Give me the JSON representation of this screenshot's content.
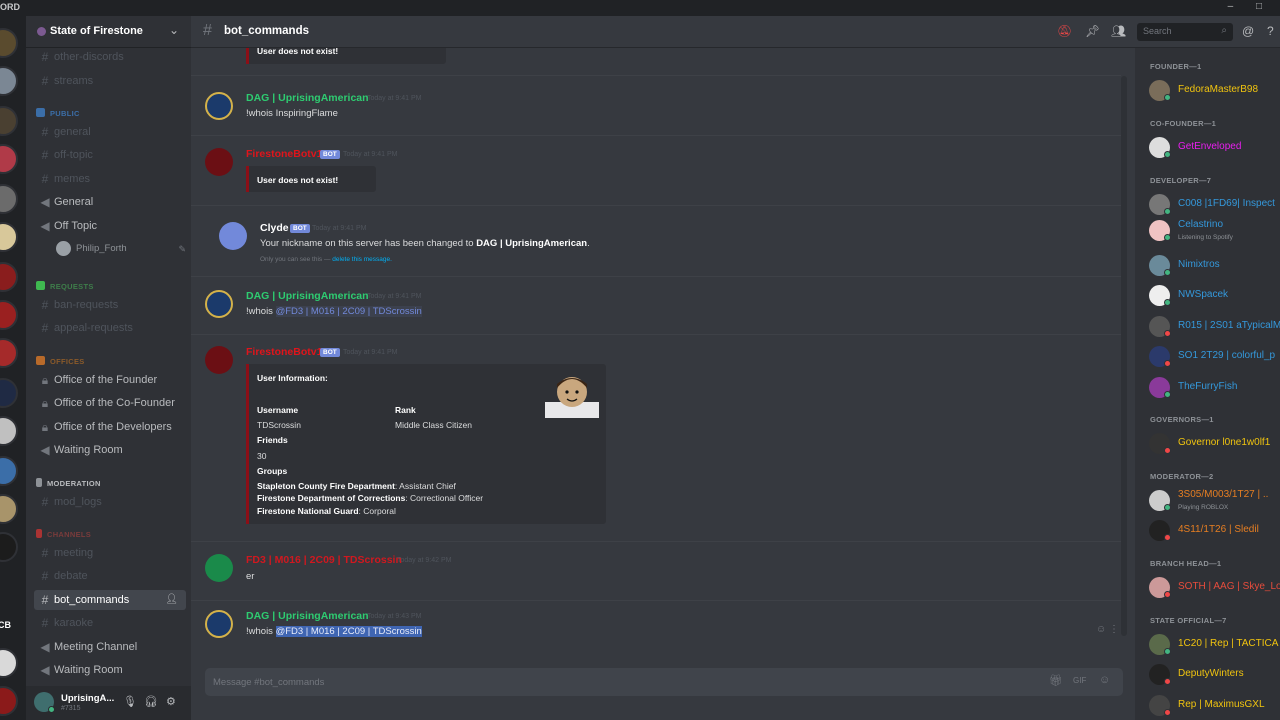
{
  "titlebar": {
    "brand": "ORD",
    "controls": "– □"
  },
  "server": {
    "name": "State of Firestone"
  },
  "channels": [
    {
      "label": "other-discords",
      "kind": "text",
      "state": "muted"
    },
    {
      "label": "streams",
      "kind": "text",
      "state": "muted"
    },
    {
      "label": "general",
      "kind": "text",
      "state": "muted"
    },
    {
      "label": "off-topic",
      "kind": "text",
      "state": "muted"
    },
    {
      "label": "memes",
      "kind": "text",
      "state": "muted"
    },
    {
      "label": "General",
      "kind": "voice",
      "state": "normal"
    },
    {
      "label": "Off Topic",
      "kind": "voice",
      "state": "normal"
    },
    {
      "label": "ban-requests",
      "kind": "text",
      "state": "muted"
    },
    {
      "label": "appeal-requests",
      "kind": "text",
      "state": "muted"
    },
    {
      "label": "Office of the Founder",
      "kind": "locked",
      "state": "normal"
    },
    {
      "label": "Office of the Co-Founder",
      "kind": "locked",
      "state": "normal"
    },
    {
      "label": "Office of the Developers",
      "kind": "locked",
      "state": "normal"
    },
    {
      "label": "Waiting Room",
      "kind": "voice",
      "state": "normal"
    },
    {
      "label": "mod_logs",
      "kind": "text",
      "state": "muted"
    },
    {
      "label": "meeting",
      "kind": "text",
      "state": "muted"
    },
    {
      "label": "debate",
      "kind": "text",
      "state": "muted"
    },
    {
      "label": "bot_commands",
      "kind": "text",
      "state": "active"
    },
    {
      "label": "karaoke",
      "kind": "text",
      "state": "muted"
    },
    {
      "label": "Meeting Channel",
      "kind": "voice",
      "state": "normal"
    },
    {
      "label": "Waiting Room",
      "kind": "voice",
      "state": "normal"
    }
  ],
  "categories": [
    {
      "label": "PUBLIC",
      "color": "#3b6ea8"
    },
    {
      "label": "REQUESTS",
      "color": "#3e7d4a"
    },
    {
      "label": "OFFICES",
      "color": "#8a5a2a"
    },
    {
      "label": "MODERATION",
      "color": "#8e9297"
    },
    {
      "label": "CHANNELS",
      "color": "#7a3b3b"
    }
  ],
  "voice_user": {
    "name": "Philip_Forth"
  },
  "current_user": {
    "name": "UprisingA...",
    "tag": "#7315"
  },
  "topbar": {
    "channel": "bot_commands",
    "search_placeholder": "Search"
  },
  "messages": [
    {
      "author": "",
      "timestamp": "",
      "embed_text": "User does not exist!"
    },
    {
      "author": "DAG | UprisingAmerican",
      "timestamp": "Today at 9:41 PM",
      "text": "!whois InspiringFlame"
    },
    {
      "author": "FirestoneBotv1",
      "bot_tag": "BOT",
      "timestamp": "Today at 9:41 PM",
      "embed_text": "User does not exist!"
    },
    {
      "author": "Clyde",
      "bot_tag": "BOT",
      "timestamp": "Today at 9:41 PM",
      "text_prefix": "Your nickname on this server has been changed to ",
      "text_bold": "DAG | UprisingAmerican",
      "text_suffix": ".",
      "note": "Only you can see this — ",
      "note_link": "delete this message."
    },
    {
      "author": "DAG | UprisingAmerican",
      "timestamp": "Today at 9:41 PM",
      "text": "!whois",
      "mention": "@FD3 | M016 | 2C09 | TDScrossin"
    },
    {
      "author": "FirestoneBotv1",
      "bot_tag": "BOT",
      "timestamp": "Today at 9:41 PM",
      "embed": {
        "title": "User Information:",
        "username_label": "Username",
        "username": "TDScrossin",
        "rank_label": "Rank",
        "rank": "Middle Class Citizen",
        "friends_label": "Friends",
        "friends": "30",
        "groups_label": "Groups",
        "groups": [
          {
            "name": "Stapleton County Fire Department",
            "role": ": Assistant Chief"
          },
          {
            "name": "Firestone Department of Corrections",
            "role": ": Correctional Officer"
          },
          {
            "name": "Firestone National Guard",
            "role": ": Corporal"
          }
        ]
      }
    },
    {
      "author": "FD3 | M016 | 2C09 | TDScrossin",
      "timestamp": "Today at 9:42 PM",
      "text": "er"
    },
    {
      "author": "DAG | UprisingAmerican",
      "timestamp": "Today at 9:43 PM",
      "text": "!whois",
      "mention": "@FD3 | M016 | 2C09 | TDScrossin"
    }
  ],
  "composer": {
    "placeholder": "Message #bot_commands"
  },
  "members": {
    "roles": [
      "FOUNDER—1",
      "CO-FOUNDER—1",
      "DEVELOPER—7",
      "GOVERNORS—1",
      "MODERATOR—2",
      "BRANCH HEAD—1",
      "STATE OFFICIAL—7"
    ],
    "list": [
      {
        "name": "FedoraMasterB98",
        "color": "#f1c40f",
        "status": "#43b581",
        "sub": ""
      },
      {
        "name": "GetEnveloped",
        "color": "#e91ef0",
        "status": "#43b581",
        "sub": ""
      },
      {
        "name": "C008 |1FD69| Inspect",
        "color": "#3498db",
        "status": "#43b581",
        "sub": ""
      },
      {
        "name": "Celastrino",
        "color": "#3498db",
        "status": "#43b581",
        "sub": "Listening to Spotify"
      },
      {
        "name": "Nimixtros",
        "color": "#3498db",
        "status": "#43b581",
        "sub": ""
      },
      {
        "name": "NWSpacek",
        "color": "#3498db",
        "status": "#43b581",
        "sub": ""
      },
      {
        "name": "R015 | 2S01 aTypicalM",
        "color": "#3498db",
        "status": "#f04747",
        "sub": ""
      },
      {
        "name": "SO1 2T29 | colorful_p",
        "color": "#3498db",
        "status": "#f04747",
        "sub": ""
      },
      {
        "name": "TheFurryFish",
        "color": "#3498db",
        "status": "#43b581",
        "sub": ""
      },
      {
        "name": "Governor l0ne1w0lf1",
        "color": "#f1c40f",
        "status": "#f04747",
        "sub": ""
      },
      {
        "name": "3S05/M003/1T27 | ..",
        "color": "#e67e22",
        "status": "#43b581",
        "sub": "Playing ROBLOX"
      },
      {
        "name": "4S11/1T26 | Sledil",
        "color": "#e67e22",
        "status": "#f04747",
        "sub": ""
      },
      {
        "name": "SOTH | AAG | Skye_Lo",
        "color": "#e74c3c",
        "status": "#f04747",
        "sub": ""
      },
      {
        "name": "1C20 | Rep | TACTICA",
        "color": "#f1c40f",
        "status": "#43b581",
        "sub": ""
      },
      {
        "name": "DeputyWinters",
        "color": "#f1c40f",
        "status": "#f04747",
        "sub": ""
      },
      {
        "name": "Rep | MaximusGXL",
        "color": "#f1c40f",
        "status": "#f04747",
        "sub": ""
      }
    ]
  },
  "colors": {
    "username_green": "#2ecc71",
    "bot_red": "#e0141b",
    "mention_blue": "#7289da"
  }
}
